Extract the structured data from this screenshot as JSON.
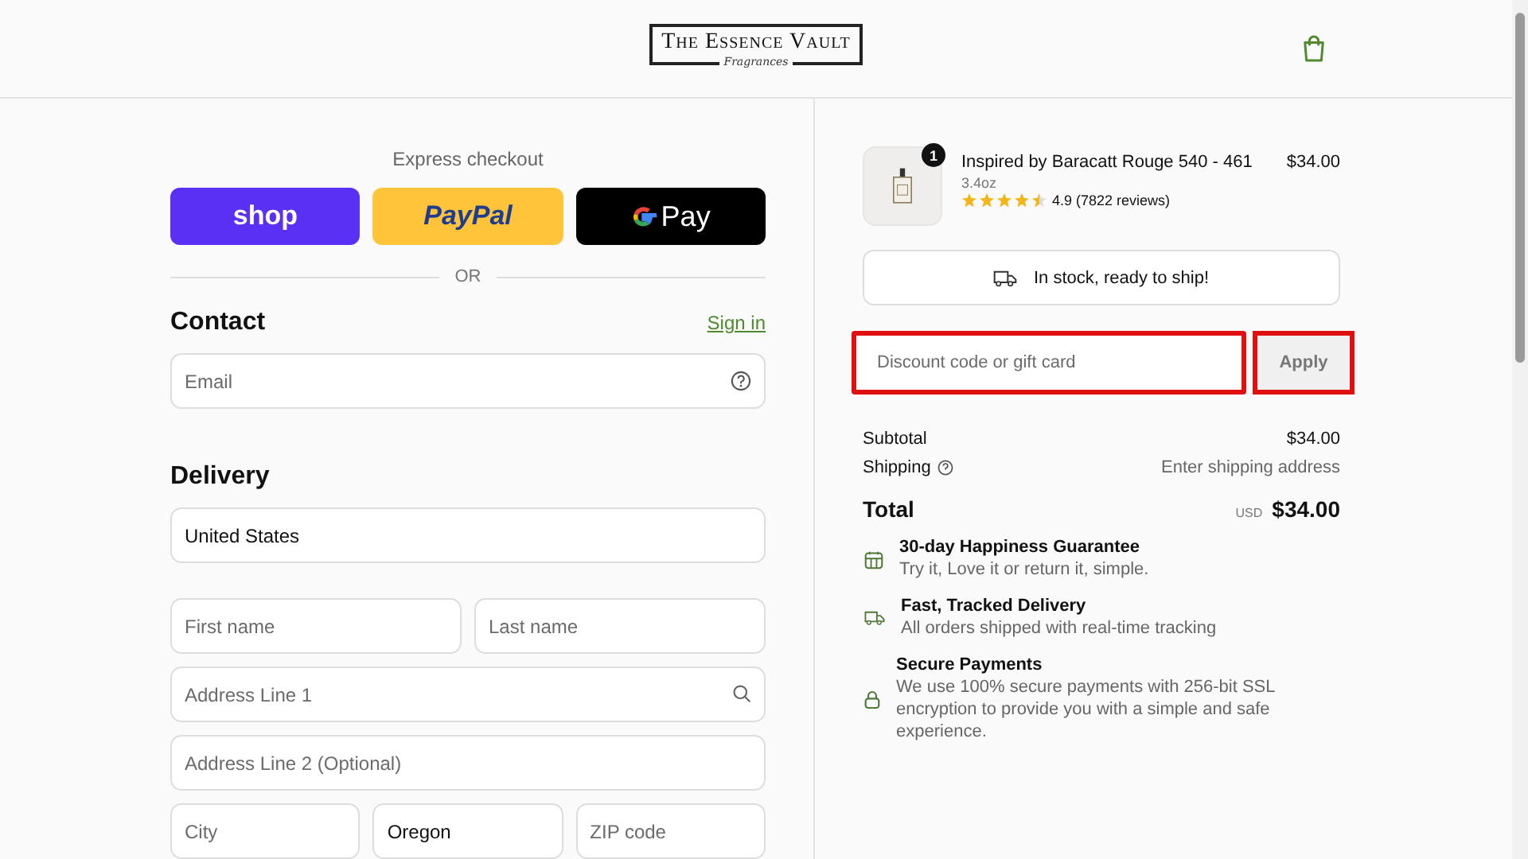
{
  "header": {
    "logo": {
      "title": "The Essence Vault",
      "subtitle": "Fragrances"
    }
  },
  "express_checkout": {
    "label": "Express checkout",
    "buttons": [
      {
        "kind": "shop",
        "label": "shop"
      },
      {
        "kind": "paypal",
        "label": "PayPal"
      },
      {
        "kind": "gpay",
        "label": "Pay"
      }
    ],
    "divider": "OR"
  },
  "contact": {
    "title": "Contact",
    "link": "Sign in",
    "email": {
      "placeholder": "Email"
    }
  },
  "delivery": {
    "title": "Delivery",
    "fields": [
      {
        "kind": "select",
        "value": "United States"
      },
      {
        "kind": "text",
        "placeholder": "First name"
      },
      {
        "kind": "text",
        "placeholder": "Last name"
      },
      {
        "kind": "search",
        "placeholder": "Address Line 1"
      },
      {
        "kind": "text",
        "placeholder": "Address Line 2 (Optional)"
      },
      {
        "kind": "text",
        "placeholder": "City"
      },
      {
        "kind": "select",
        "value": "Oregon"
      },
      {
        "kind": "text",
        "placeholder": "ZIP code"
      }
    ]
  },
  "order": {
    "item": {
      "name": "Inspired by Baracatt Rouge 540 - 461",
      "size": "3.4oz",
      "stars": 4.5,
      "rating": "4.9 (7822 reviews)",
      "price": "$34.00",
      "quantity": "1"
    },
    "stock": "In stock, ready to ship!",
    "discount": {
      "placeholder": "Discount code or gift card",
      "highlighted": true
    },
    "apply": {
      "label": "Apply",
      "highlighted": true
    },
    "subtotal": {
      "label": "Subtotal",
      "value": "$34.00"
    },
    "shipping": {
      "label": "Shipping",
      "value": "Enter shipping address"
    },
    "total": {
      "label": "Total",
      "currency": "USD",
      "value": "$34.00"
    },
    "features": [
      {
        "kind": "calendar",
        "title": "30-day Happiness Guarantee",
        "text": "Try it, Love it or return it, simple."
      },
      {
        "kind": "truck",
        "title": "Fast, Tracked Delivery",
        "text": "All orders shipped with real-time tracking"
      },
      {
        "kind": "lock",
        "title": "Secure Payments",
        "text": "We use 100% secure payments with 256-bit SSL encryption to provide you with a simple and safe experience."
      }
    ]
  }
}
